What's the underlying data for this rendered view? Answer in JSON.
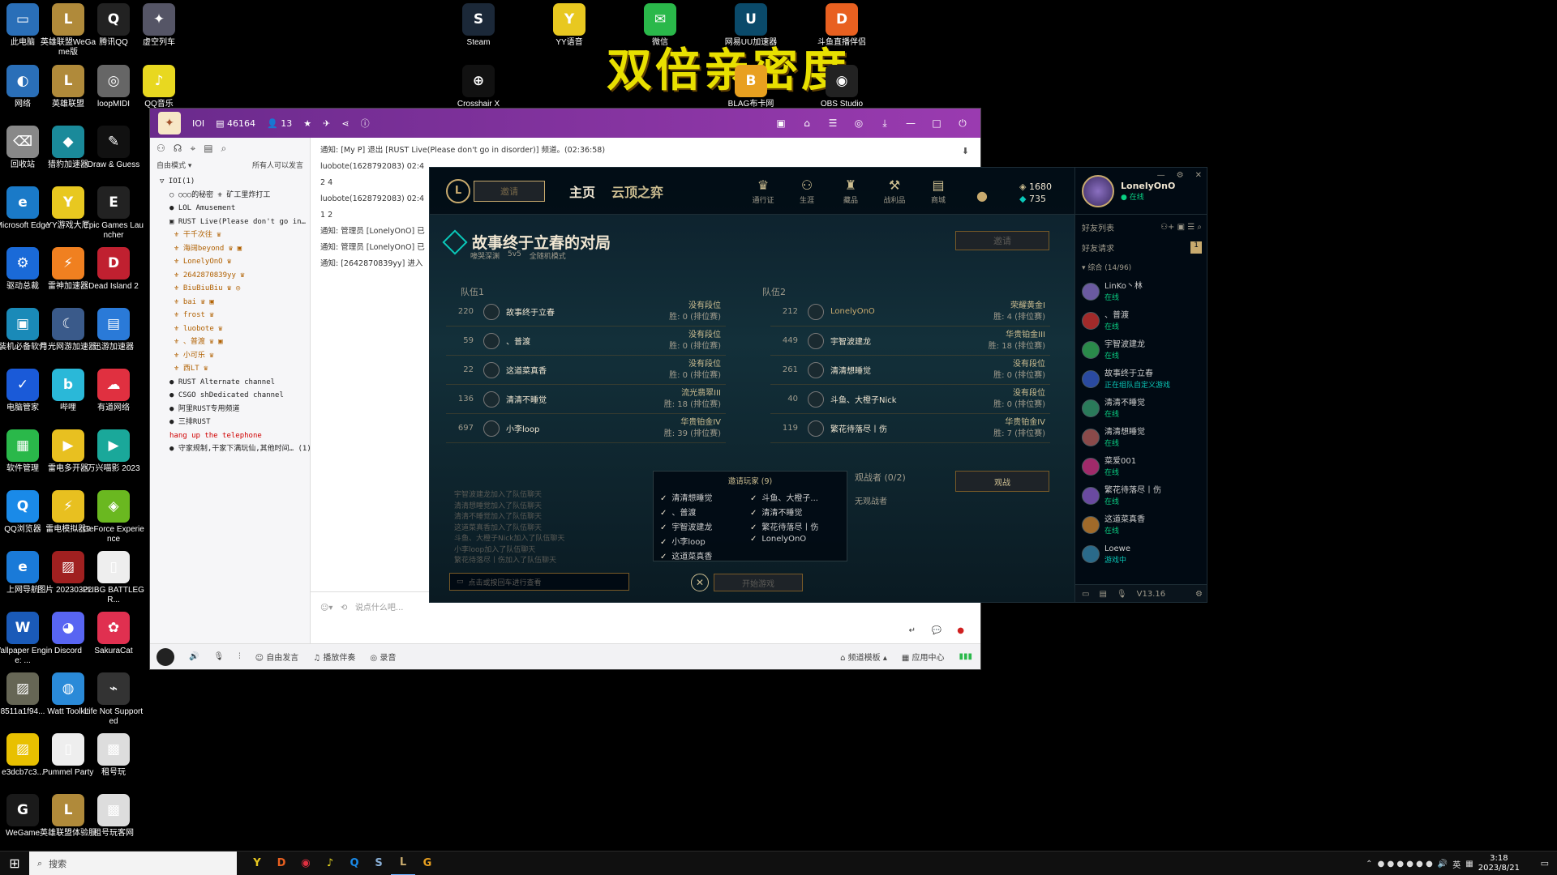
{
  "banner": "双倍亲密度",
  "desktop": {
    "icons": [
      {
        "label": "此电脑",
        "color": "#2a6fb8",
        "glyph": "▭"
      },
      {
        "label": "英雄联盟WeGame版",
        "color": "#b08a3a",
        "glyph": "L"
      },
      {
        "label": "腾讯QQ",
        "color": "#222",
        "glyph": "Q"
      },
      {
        "label": "虚空列车",
        "color": "#556",
        "glyph": "✦"
      },
      {
        "label": "网络",
        "color": "#2a6fb8",
        "glyph": "◐"
      },
      {
        "label": "英雄联盟",
        "color": "#b08a3a",
        "glyph": "L"
      },
      {
        "label": "loopMIDI",
        "color": "#666",
        "glyph": "◎"
      },
      {
        "label": "QQ音乐",
        "color": "#e8d820",
        "glyph": "♪"
      },
      {
        "label": "回收站",
        "color": "#888",
        "glyph": "⌫"
      },
      {
        "label": "猎豹加速器",
        "color": "#1a8a9a",
        "glyph": "◆"
      },
      {
        "label": "Draw & Guess",
        "color": "#111",
        "glyph": "✎"
      },
      {
        "label": "Microsoft Edge",
        "color": "#1a7ac8",
        "glyph": "e"
      },
      {
        "label": "YY游戏大厅",
        "color": "#e8c820",
        "glyph": "Y"
      },
      {
        "label": "Epic Games Launcher",
        "color": "#222",
        "glyph": "E"
      },
      {
        "label": "驱动总裁",
        "color": "#1a6ad8",
        "glyph": "⚙"
      },
      {
        "label": "雷神加速器",
        "color": "#f08020",
        "glyph": "⚡"
      },
      {
        "label": "Dead Island 2",
        "color": "#c02030",
        "glyph": "D"
      },
      {
        "label": "装机必备软件",
        "color": "#1a8ab8",
        "glyph": "▣"
      },
      {
        "label": "月光网游加速器",
        "color": "#3a5a8a",
        "glyph": "☾"
      },
      {
        "label": "迅游加速器",
        "color": "#2a7ad8",
        "glyph": "▤"
      },
      {
        "label": "电脑管家",
        "color": "#1a5ad8",
        "glyph": "✓"
      },
      {
        "label": "哔哩",
        "color": "#2ab8d8",
        "glyph": "b"
      },
      {
        "label": "有道网络",
        "color": "#e03040",
        "glyph": "☁"
      },
      {
        "label": "软件管理",
        "color": "#2ab84a",
        "glyph": "▦"
      },
      {
        "label": "雷电多开器",
        "color": "#e8c020",
        "glyph": "▶"
      },
      {
        "label": "万兴喵影 2023",
        "color": "#1aa89a",
        "glyph": "▶"
      },
      {
        "label": "QQ浏览器",
        "color": "#1a8ae8",
        "glyph": "Q"
      },
      {
        "label": "雷电模拟器9",
        "color": "#e8c020",
        "glyph": "⚡"
      },
      {
        "label": "GeForce Experience",
        "color": "#6ab820",
        "glyph": "◈"
      },
      {
        "label": "上网导航",
        "color": "#1a7ad8",
        "glyph": "e"
      },
      {
        "label": "图片 20230322...",
        "color": "#a02020",
        "glyph": "▨"
      },
      {
        "label": "PUBG BATTLEGR...",
        "color": "#eee",
        "glyph": "▯"
      },
      {
        "label": "Wallpaper Engine: ...",
        "color": "#1a5ab8",
        "glyph": "W"
      },
      {
        "label": "Discord",
        "color": "#5865f2",
        "glyph": "◕"
      },
      {
        "label": "SakuraCat",
        "color": "#e03050",
        "glyph": "✿"
      },
      {
        "label": "8511a1f94...",
        "color": "#665",
        "glyph": "▨"
      },
      {
        "label": "Watt Toolkit",
        "color": "#2a8ad8",
        "glyph": "◍"
      },
      {
        "label": "Life Not Supported",
        "color": "#333",
        "glyph": "⌁"
      },
      {
        "label": "e3dcb7c3...",
        "color": "#e8c000",
        "glyph": "▨"
      },
      {
        "label": "Pummel Party",
        "color": "#eee",
        "glyph": "▯"
      },
      {
        "label": "租号玩",
        "color": "#ddd",
        "glyph": "▩"
      },
      {
        "label": "WeGame",
        "color": "#1a1a1a",
        "glyph": "G"
      },
      {
        "label": "英雄联盟体验服",
        "color": "#b08a3a",
        "glyph": "L"
      },
      {
        "label": "租号玩客网",
        "color": "#ddd",
        "glyph": "▩"
      },
      {
        "label": "Steam",
        "color": "#1b2838",
        "glyph": "S"
      },
      {
        "label": "YY语音",
        "color": "#e8c820",
        "glyph": "Y"
      },
      {
        "label": "微信",
        "color": "#2ab84a",
        "glyph": "✉"
      },
      {
        "label": "网易UU加速器",
        "color": "#0a4a6a",
        "glyph": "U"
      },
      {
        "label": "斗鱼直播伴侣",
        "color": "#e86020",
        "glyph": "D"
      },
      {
        "label": "Crosshair X",
        "color": "#111",
        "glyph": "⊕"
      },
      {
        "label": "BLAG布卡网",
        "color": "#e8a020",
        "glyph": "B"
      },
      {
        "label": "OBS Studio",
        "color": "#222",
        "glyph": "◉"
      }
    ]
  },
  "taskbar": {
    "search_placeholder": "搜索",
    "time": "3:18",
    "date": "2023/8/21",
    "ime": "英"
  },
  "yy": {
    "title": "IOI",
    "online_count": "46164",
    "member_count": "13",
    "mode": "自由模式",
    "mode_hint": "所有人可以发言",
    "channels": [
      {
        "text": "▽ IOI(1)",
        "type": "ch"
      },
      {
        "text": "○ ○○○的秘密 ⚜ 矿工里炸打工",
        "type": "sub"
      },
      {
        "text": "● LOL  Amusement",
        "type": "sub"
      },
      {
        "text": "▣ RUST  Live(Please don't go in… (1)",
        "type": "sub"
      },
      {
        "text": "⚜ 干千次往 ♛",
        "type": "user"
      },
      {
        "text": "⚜ 海阔beyond ♛ ▣",
        "type": "user"
      },
      {
        "text": "⚜ LonelyOnO ♛",
        "type": "user"
      },
      {
        "text": "⚜ 2642870839yy ♛",
        "type": "user"
      },
      {
        "text": "⚜ BiuBiuBiu ♛ ◎",
        "type": "user"
      },
      {
        "text": "⚜ bai ♛ ▣",
        "type": "user"
      },
      {
        "text": "⚜ frost ♛",
        "type": "user"
      },
      {
        "text": "⚜ luobote ♛",
        "type": "user"
      },
      {
        "text": "⚜ 、普渡 ♛ ▣",
        "type": "user"
      },
      {
        "text": "⚜ 小可乐 ♛",
        "type": "user"
      },
      {
        "text": "⚜ 西LT ♛",
        "type": "user"
      },
      {
        "text": "● RUST  Alternate channel",
        "type": "sub"
      },
      {
        "text": "● CSGO  shDedicated channel",
        "type": "sub"
      },
      {
        "text": "● 阿里RUST专用频道",
        "type": "sub"
      },
      {
        "text": "● 三排RUST",
        "type": "sub"
      },
      {
        "text": "hang up the telephone",
        "type": "red"
      },
      {
        "text": "● 守家规制,干家下满玩仙,其他时间… (1)",
        "type": "sub"
      }
    ],
    "messages": [
      {
        "html": "通知: [My P] 退出 [RUST  Live(Please don't go in disorder)] 频道。(02:36:58)"
      },
      {
        "html": "luobote(1628792083) 02:4"
      },
      {
        "html": "2 4"
      },
      {
        "html": "luobote(1628792083) 02:4"
      },
      {
        "html": "1 2"
      },
      {
        "html": "通知: 管理员 [LonelyOnO] 已"
      },
      {
        "html": "通知: 管理员 [LonelyOnO] 已"
      },
      {
        "html": "通知: [2642870839yy] 进入"
      }
    ],
    "input_placeholder": "说点什么吧...",
    "bottom": {
      "free": "自由发言",
      "music": "播放伴奏",
      "record": "录音",
      "template": "频道模板",
      "app_center": "应用中心"
    }
  },
  "lol": {
    "play": "邀请",
    "tabs": [
      "主页",
      "云顶之弈"
    ],
    "nav": [
      "通行证",
      "生涯",
      "藏品",
      "战利品",
      "商城"
    ],
    "rp": "1680",
    "be": "735",
    "lobby_title": "故事终于立春的对局",
    "lobby_map": "嚎哭深渊",
    "lobby_size": "5v5",
    "lobby_mode": "全随机模式",
    "invite_btn": "邀请",
    "team1_label": "队伍1",
    "team2_label": "队伍2",
    "team1": [
      {
        "level": "220",
        "name": "故事终于立春",
        "tier": "没有段位",
        "wins": "胜: 0 (排位赛)",
        "me": false
      },
      {
        "level": "59",
        "name": "、普渡",
        "tier": "没有段位",
        "wins": "胜: 0 (排位赛)",
        "me": false
      },
      {
        "level": "22",
        "name": "这道菜真香",
        "tier": "没有段位",
        "wins": "胜: 0 (排位赛)",
        "me": false
      },
      {
        "level": "136",
        "name": "清清不睡觉",
        "tier": "流光翡翠III",
        "wins": "胜: 18 (排位赛)",
        "me": false
      },
      {
        "level": "697",
        "name": "小李loop",
        "tier": "华贵铂金IV",
        "wins": "胜: 39 (排位赛)",
        "me": false
      }
    ],
    "team2": [
      {
        "level": "212",
        "name": "LonelyOnO",
        "tier": "荣耀黄金I",
        "wins": "胜: 4 (排位赛)",
        "me": true
      },
      {
        "level": "449",
        "name": "宇智波建龙",
        "tier": "华贵铂金III",
        "wins": "胜: 18 (排位赛)",
        "me": false
      },
      {
        "level": "261",
        "name": "清清想睡觉",
        "tier": "没有段位",
        "wins": "胜: 0 (排位赛)",
        "me": false
      },
      {
        "level": "40",
        "name": "斗鱼、大橙子Nick",
        "tier": "没有段位",
        "wins": "胜: 0 (排位赛)",
        "me": false
      },
      {
        "level": "119",
        "name": "繁花待落尽丨伤",
        "tier": "华贵铂金IV",
        "wins": "胜: 7 (排位赛)",
        "me": false
      }
    ],
    "spectators": "观战者 (0/2)",
    "no_spectators": "无观战者",
    "watch_btn": "观战",
    "invited_header": "邀请玩家 (9)",
    "invited": [
      "清清想睡觉",
      "斗鱼、大橙子...",
      "、普渡",
      "清清不睡觉",
      "宇智波建龙",
      "繁花待落尽丨伤",
      "小李loop",
      "LonelyOnO",
      "这道菜真香"
    ],
    "feed": [
      "宇智波建龙加入了队伍聊天",
      "清清想睡觉加入了队伍聊天",
      "清清不睡觉加入了队伍聊天",
      "这道菜真香加入了队伍聊天",
      "斗鱼、大橙子Nick加入了队伍聊天",
      "小李loop加入了队伍聊天",
      "繁花待落尽丨伤加入了队伍聊天"
    ],
    "chat_placeholder": "点击或按回车进行查看",
    "start_btn": "开始游戏",
    "profile": {
      "name": "LonelyOnO",
      "status": "在线",
      "level": "212"
    },
    "friends_label": "好友列表",
    "friend_requests": "好友请求",
    "friend_requests_count": "1",
    "group": "▾ 综合 (14/96)",
    "friends": [
      {
        "name": "LinKo丶林",
        "status": "在线",
        "color": "#6a5aa0"
      },
      {
        "name": "、普渡",
        "status": "在线",
        "color": "#a02a2a"
      },
      {
        "name": "宇智波建龙",
        "status": "在线",
        "color": "#2a8a4a"
      },
      {
        "name": "故事终于立春",
        "status": "正在组队自定义游戏",
        "color": "#2a4aa0"
      },
      {
        "name": "清清不睡觉",
        "status": "在线",
        "color": "#2a7a5a"
      },
      {
        "name": "清清想睡觉",
        "status": "在线",
        "color": "#8a4a4a"
      },
      {
        "name": "菜爱001",
        "status": "在线",
        "color": "#a02a6a"
      },
      {
        "name": "繁花待落尽丨伤",
        "status": "在线",
        "color": "#6a4aa0"
      },
      {
        "name": "这道菜真香",
        "status": "在线",
        "color": "#a06a2a"
      },
      {
        "name": "Loewe",
        "status": "游戏中",
        "color": "#2a6a8a"
      }
    ],
    "version": "V13.16"
  }
}
